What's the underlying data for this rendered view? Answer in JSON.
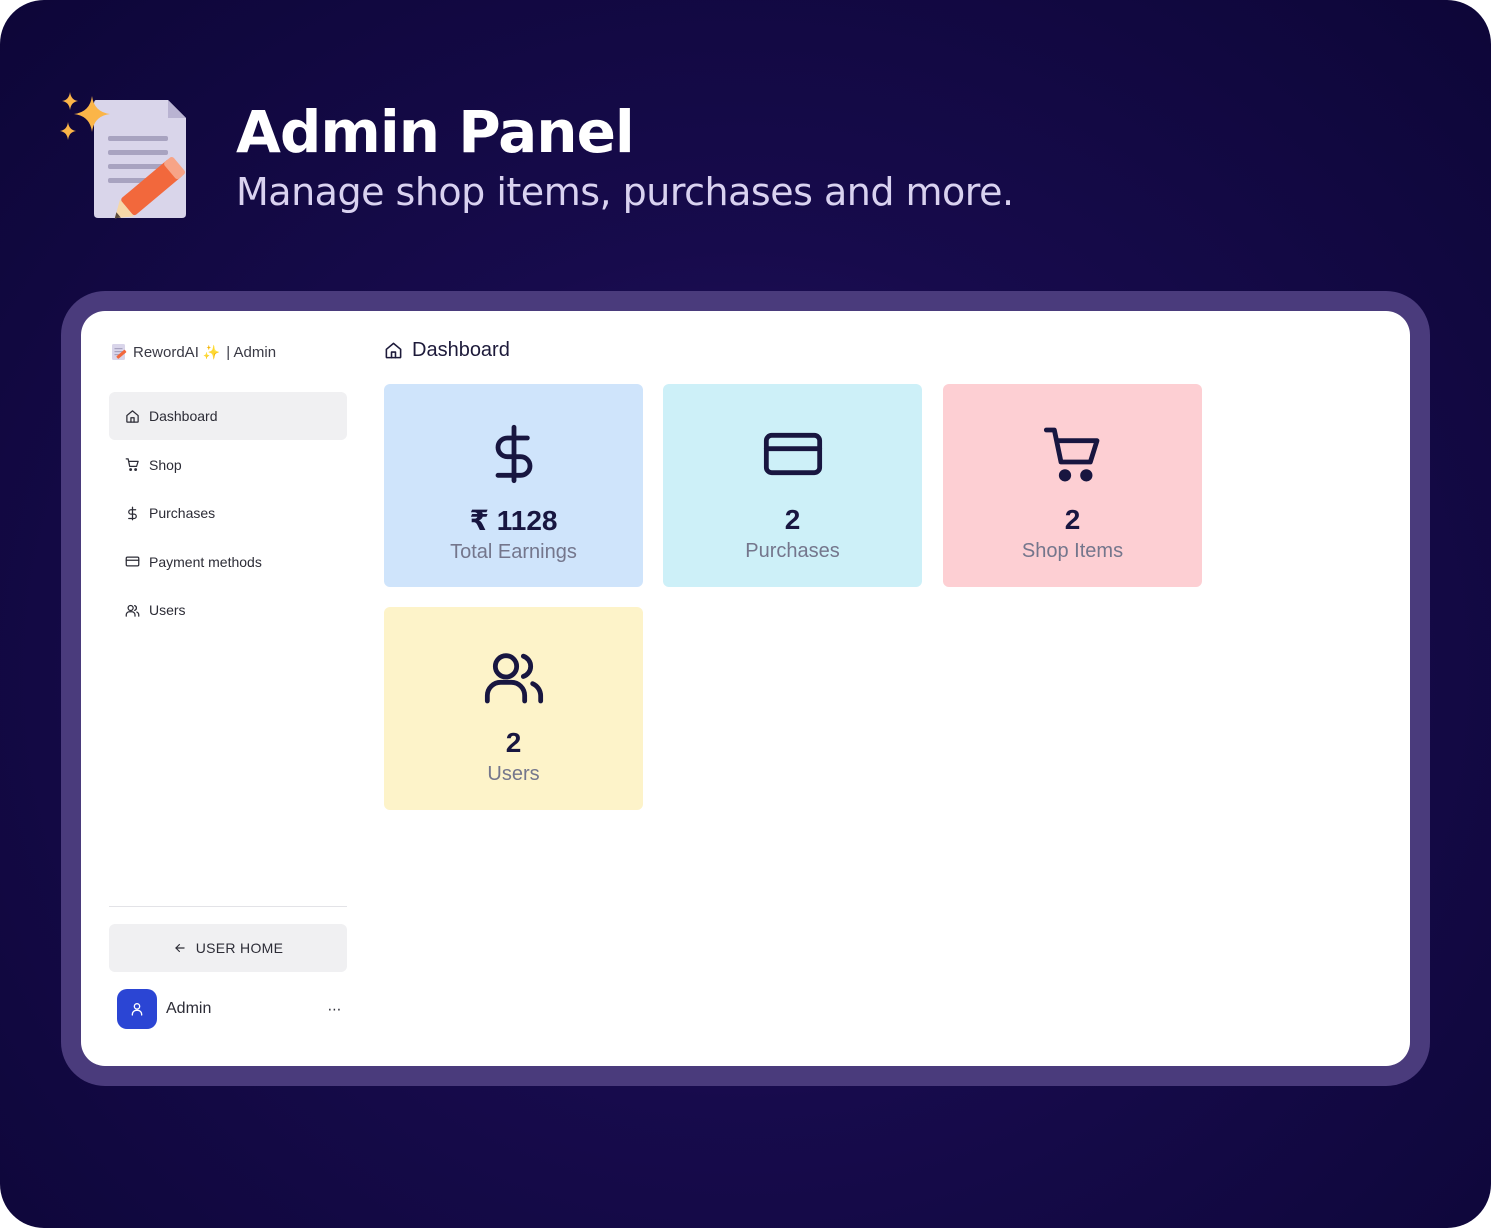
{
  "hero": {
    "title": "Admin Panel",
    "subtitle": "Manage shop items, purchases and more.",
    "icon": "memo-with-pencil-and-sparkles-icon"
  },
  "sidebar": {
    "brand_name": "RewordAI",
    "brand_suffix": "| Admin",
    "items": [
      {
        "label": "Dashboard",
        "icon": "home-icon",
        "active": true
      },
      {
        "label": "Shop",
        "icon": "cart-icon",
        "active": false
      },
      {
        "label": "Purchases",
        "icon": "dollar-icon",
        "active": false
      },
      {
        "label": "Payment methods",
        "icon": "credit-card-icon",
        "active": false
      },
      {
        "label": "Users",
        "icon": "users-icon",
        "active": false
      }
    ],
    "user_home_label": "USER HOME",
    "profile_name": "Admin",
    "more_label": "⋯"
  },
  "main": {
    "page_title": "Dashboard",
    "cards": [
      {
        "value": "₹ 1128",
        "label": "Total Earnings",
        "icon": "dollar-icon",
        "color": "#cfe4fb"
      },
      {
        "value": "2",
        "label": "Purchases",
        "icon": "credit-card-icon",
        "color": "#cdf0f8"
      },
      {
        "value": "2",
        "label": "Shop Items",
        "icon": "cart-icon",
        "color": "#fdcfd3"
      },
      {
        "value": "2",
        "label": "Users",
        "icon": "users-icon",
        "color": "#fdf3c9"
      }
    ]
  },
  "colors": {
    "background": "#170b4c",
    "frame": "#4a3b7c",
    "accent": "#2b45d4",
    "icon_stroke": "#181640"
  }
}
